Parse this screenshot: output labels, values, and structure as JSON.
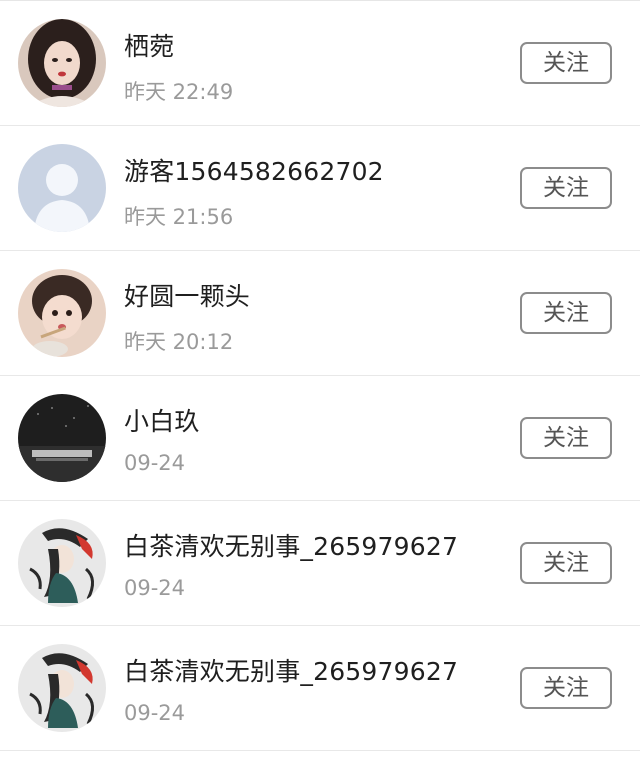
{
  "follow_label": "关注",
  "users": [
    {
      "name": "栖菀",
      "time": "昨天 22:49",
      "avatar_icon": "girl-portrait-avatar"
    },
    {
      "name": "游客1564582662702",
      "time": "昨天 21:56",
      "avatar_icon": "default-person-avatar"
    },
    {
      "name": "好圆一颗头",
      "time": "昨天 20:12",
      "avatar_icon": "child-portrait-avatar"
    },
    {
      "name": "小白玖",
      "time": "09-24",
      "avatar_icon": "stage-crowd-avatar"
    },
    {
      "name": "白茶清欢无别事_265979627",
      "time": "09-24",
      "avatar_icon": "anime-character-avatar"
    },
    {
      "name": "白茶清欢无别事_265979627",
      "time": "09-24",
      "avatar_icon": "anime-character-avatar"
    }
  ]
}
